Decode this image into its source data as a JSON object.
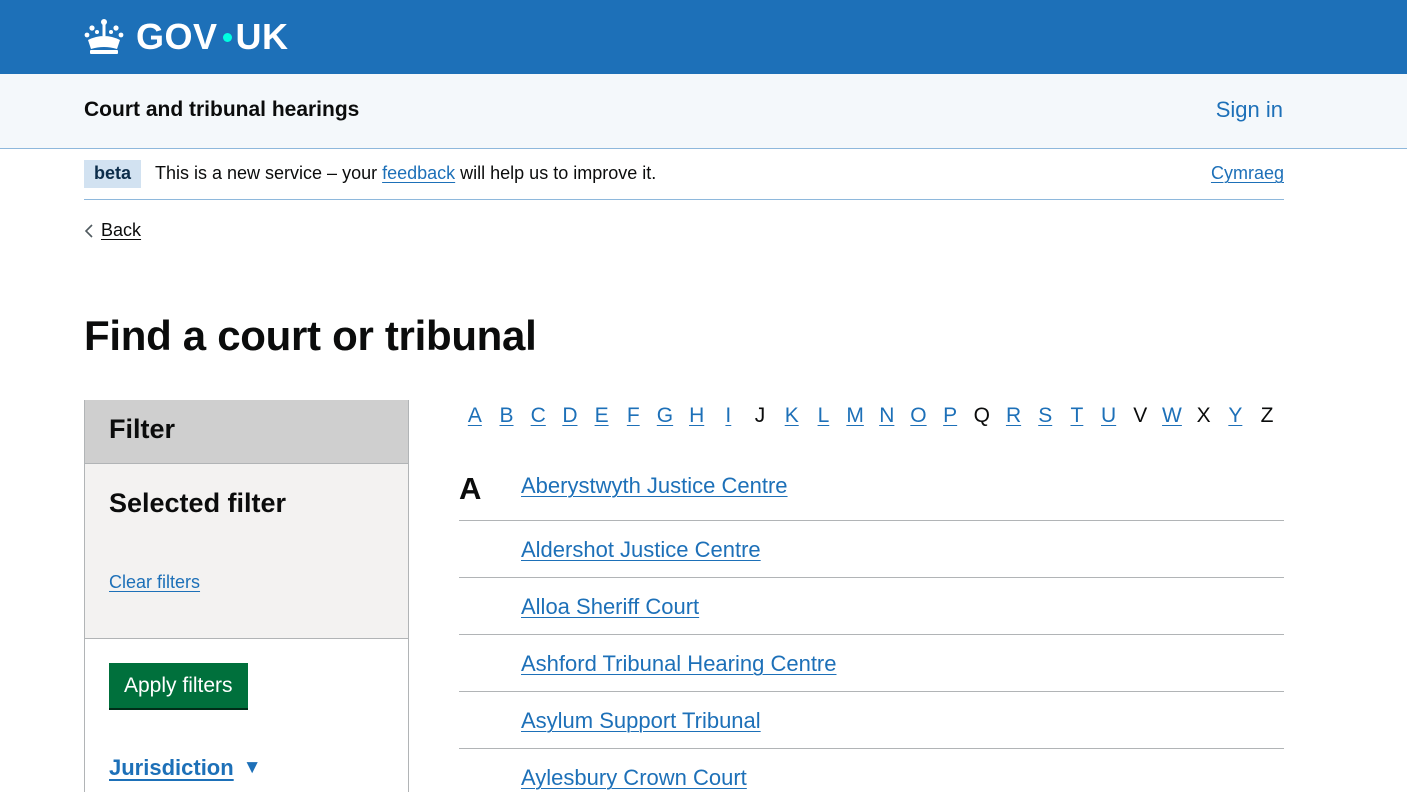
{
  "header": {
    "brand": "GOV",
    "brand_suffix": "UK"
  },
  "service": {
    "name": "Court and tribunal hearings",
    "sign_in": "Sign in"
  },
  "phase": {
    "tag": "beta",
    "text_before": "This is a new service – your ",
    "link": "feedback",
    "text_after": " will help us to improve it.",
    "language": "Cymraeg"
  },
  "back": "Back",
  "title": "Find a court or tribunal",
  "filter": {
    "heading": "Filter",
    "selected_heading": "Selected filter",
    "clear": "Clear filters",
    "apply": "Apply filters",
    "jurisdiction": "Jurisdiction"
  },
  "alphabet": [
    {
      "letter": "A",
      "link": true
    },
    {
      "letter": "B",
      "link": true
    },
    {
      "letter": "C",
      "link": true
    },
    {
      "letter": "D",
      "link": true
    },
    {
      "letter": "E",
      "link": true
    },
    {
      "letter": "F",
      "link": true
    },
    {
      "letter": "G",
      "link": true
    },
    {
      "letter": "H",
      "link": true
    },
    {
      "letter": "I",
      "link": true
    },
    {
      "letter": "J",
      "link": false
    },
    {
      "letter": "K",
      "link": true
    },
    {
      "letter": "L",
      "link": true
    },
    {
      "letter": "M",
      "link": true
    },
    {
      "letter": "N",
      "link": true
    },
    {
      "letter": "O",
      "link": true
    },
    {
      "letter": "P",
      "link": true
    },
    {
      "letter": "Q",
      "link": false
    },
    {
      "letter": "R",
      "link": true
    },
    {
      "letter": "S",
      "link": true
    },
    {
      "letter": "T",
      "link": true
    },
    {
      "letter": "U",
      "link": true
    },
    {
      "letter": "V",
      "link": false
    },
    {
      "letter": "W",
      "link": true
    },
    {
      "letter": "X",
      "link": false
    },
    {
      "letter": "Y",
      "link": true
    },
    {
      "letter": "Z",
      "link": false
    }
  ],
  "courts": {
    "letter": "A",
    "items": [
      "Aberystwyth Justice Centre",
      "Aldershot Justice Centre",
      "Alloa Sheriff Court",
      "Ashford Tribunal Hearing Centre",
      "Asylum Support Tribunal",
      "Aylesbury Crown Court"
    ]
  },
  "colors": {
    "header_blue": "#1d70b8",
    "link_blue": "#1d70b8",
    "button_green": "#00703c",
    "tag_bg": "#d2e2f1",
    "dot_turquoise": "#00ffe0"
  },
  "icons": {
    "logo": "crown-icon",
    "back": "chevron-left-icon",
    "expand": "triangle-down-icon"
  }
}
